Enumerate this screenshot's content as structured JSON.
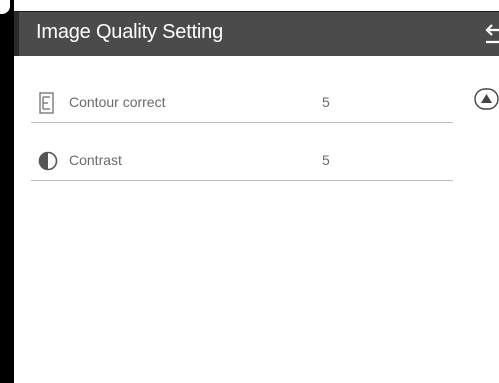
{
  "header": {
    "title": "Image Quality Setting",
    "back_icon": "return-arrow-icon"
  },
  "settings": [
    {
      "label": "Contour correct",
      "value": "5",
      "icon": "contour-icon"
    },
    {
      "label": "Contrast",
      "value": "5",
      "icon": "contrast-icon"
    }
  ],
  "scroll": {
    "up_icon": "scroll-up-icon"
  },
  "colors": {
    "header_bg": "#4b4b4b",
    "header_text": "#ffffff",
    "row_text": "#6a6a6a",
    "divider": "#bfbfbf",
    "background": "#ffffff"
  }
}
